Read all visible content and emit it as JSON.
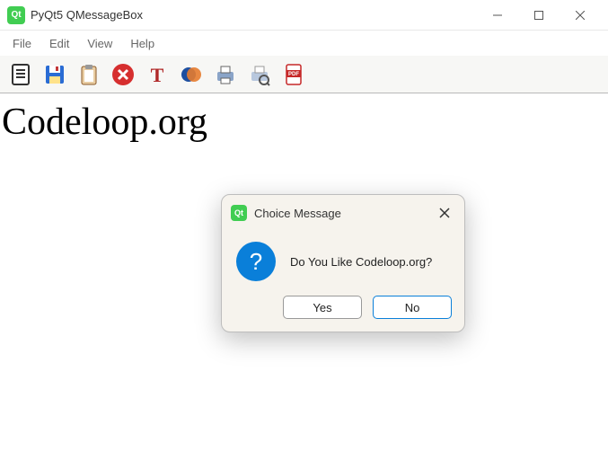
{
  "window": {
    "title": "PyQt5 QMessageBox",
    "app_icon_label": "Qt"
  },
  "menubar": [
    "File",
    "Edit",
    "View",
    "Help"
  ],
  "toolbar": [
    {
      "name": "new-doc-icon"
    },
    {
      "name": "save-icon"
    },
    {
      "name": "clipboard-icon"
    },
    {
      "name": "delete-icon"
    },
    {
      "name": "text-style-icon"
    },
    {
      "name": "color-icon"
    },
    {
      "name": "print-icon"
    },
    {
      "name": "print-preview-icon"
    },
    {
      "name": "export-pdf-icon"
    }
  ],
  "content": {
    "heading": "Codeloop.org"
  },
  "dialog": {
    "icon_label": "Qt",
    "title": "Choice Message",
    "message": "Do You Like Codeloop.org?",
    "icon_type": "question",
    "question_glyph": "?",
    "buttons": {
      "yes": "Yes",
      "no": "No"
    }
  }
}
